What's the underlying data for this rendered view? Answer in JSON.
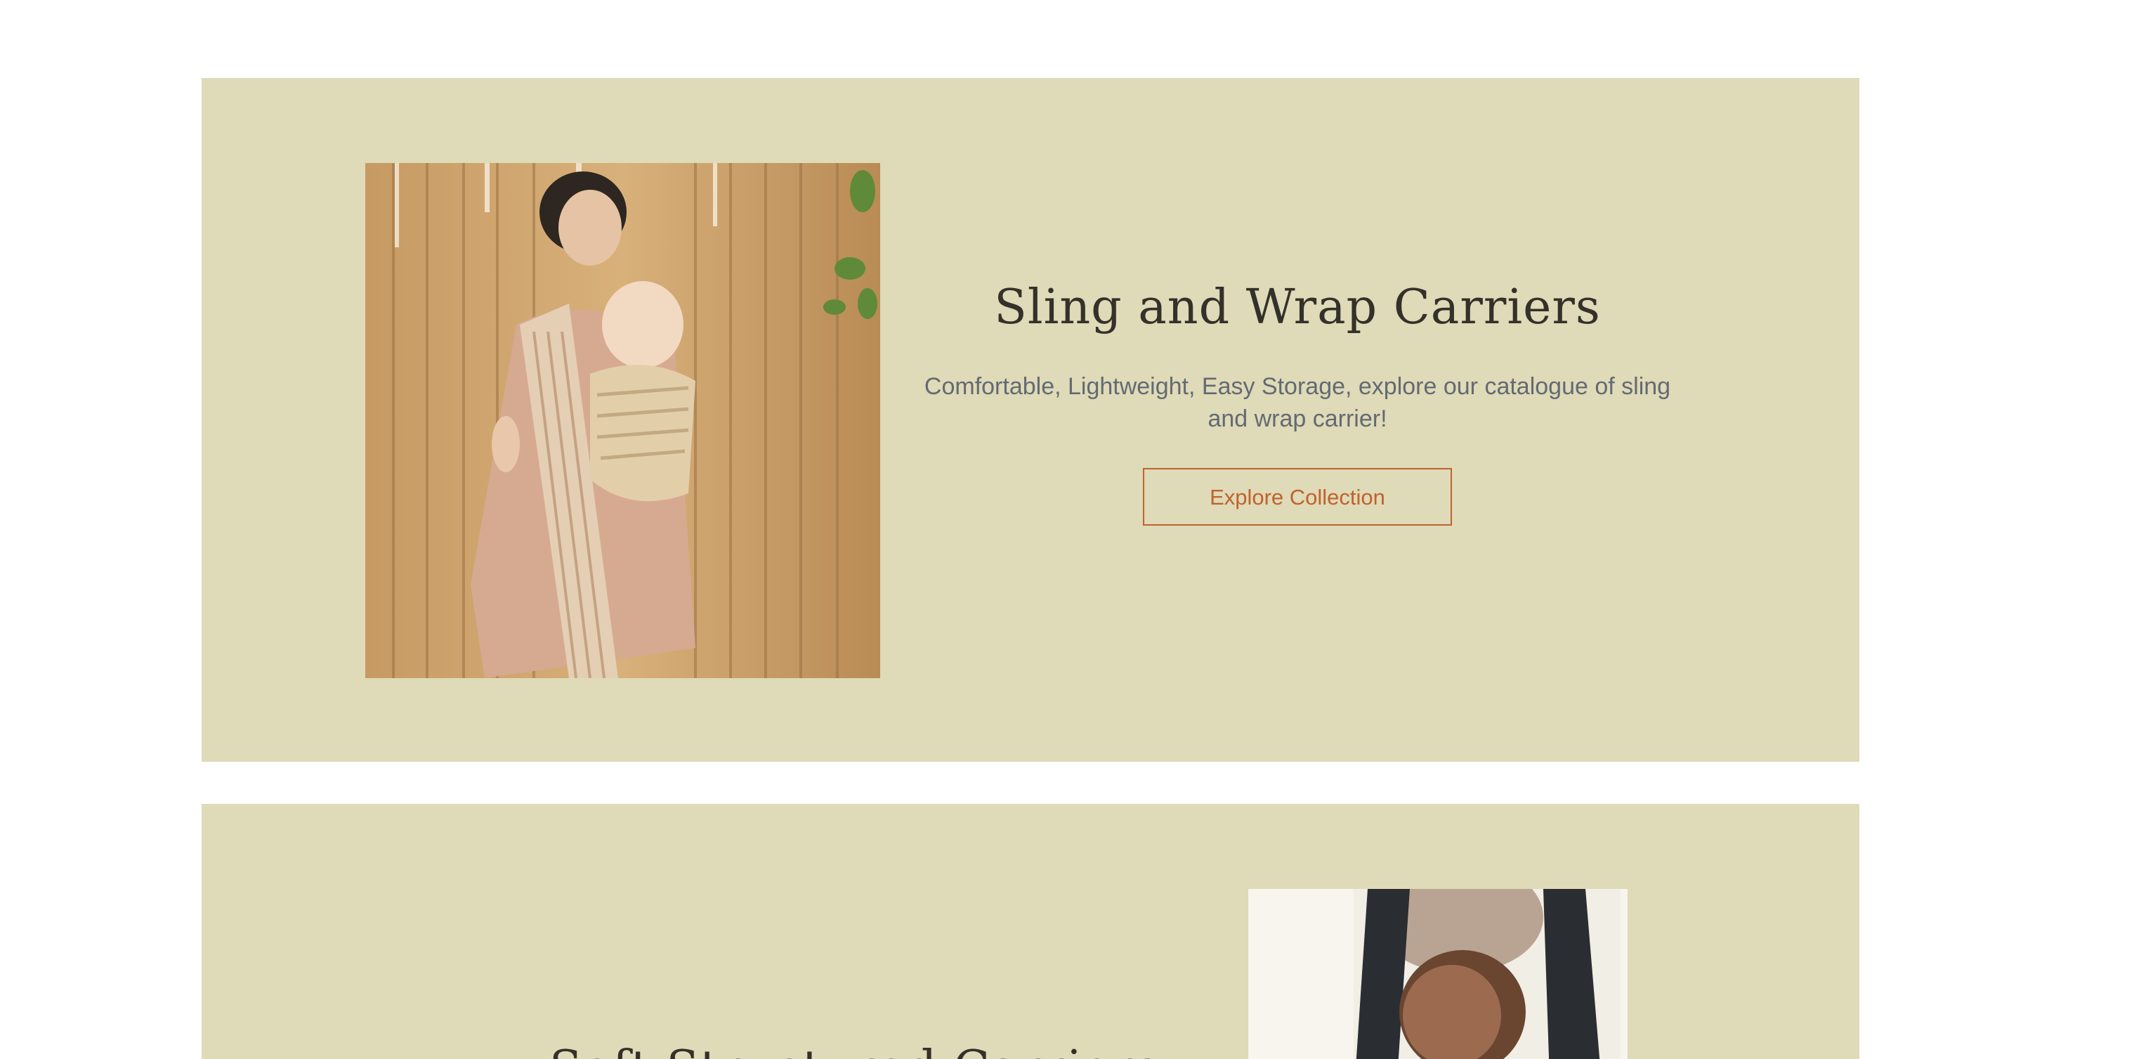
{
  "theme": {
    "band_color": "#dfdab7",
    "accent": "#c0622e",
    "title_color": "#34302a",
    "subtitle_color": "#636a73"
  },
  "sections": [
    {
      "image_alt": "Mother wearing a ring sling carrying a baby in front of a wooden fence",
      "title": "Sling and Wrap Carriers",
      "subtitle": "Comfortable, Lightweight, Easy Storage, explore our catalogue of sling and wrap carrier!",
      "cta_label": "Explore Collection"
    },
    {
      "image_alt": "Father carrying a baby in a structured carrier",
      "title": "Soft Structured Carriers"
    }
  ]
}
